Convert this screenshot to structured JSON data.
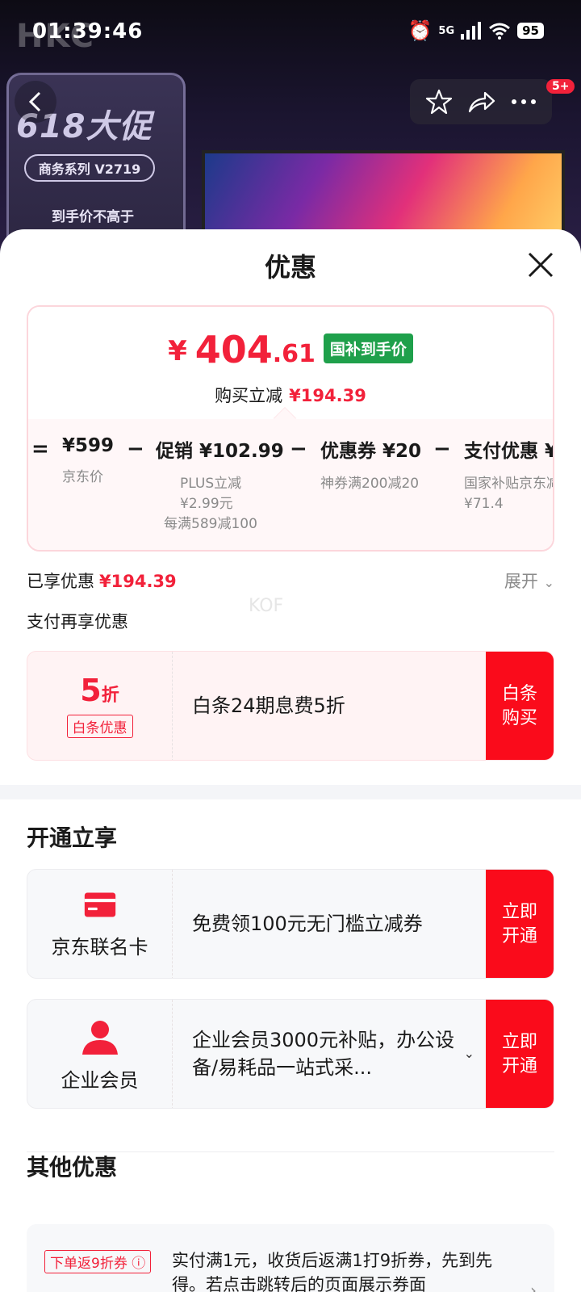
{
  "status_bar": {
    "time": "01:39:46",
    "network": "5G",
    "battery": "95"
  },
  "hero": {
    "brand": "HKC",
    "promo_title": "618大促",
    "series": "商务系列 V2719",
    "price_label": "到手价不高于",
    "badge": "5+"
  },
  "sheet": {
    "title": "优惠"
  },
  "price_card": {
    "currency": "¥",
    "price_int": "404",
    "price_dec": ".61",
    "gov_badge": "国补到手价",
    "sub_label": "购买立减",
    "sub_value": "¥194.39",
    "breakdown": [
      {
        "op": "=",
        "label": "¥599",
        "desc": "京东价"
      },
      {
        "op": "−",
        "label": "促销 ¥102.99",
        "desc": "PLUS立减¥2.99元",
        "desc2": "每满589减100"
      },
      {
        "op": "−",
        "label": "优惠券 ¥20",
        "desc": "神券满200减20"
      },
      {
        "op": "−",
        "label": "支付优惠 ¥",
        "desc": "国家补贴京东减¥71.4"
      }
    ]
  },
  "applied": {
    "label": "已享优惠",
    "value": "¥194.39",
    "expand": "展开"
  },
  "watermark": "KOF",
  "pay_more_label": "支付再享优惠",
  "baitiao": {
    "discount": "5",
    "unit": "折",
    "tag": "白条优惠",
    "desc": "白条24期息费5折",
    "button": "白条购买"
  },
  "activate": {
    "title": "开通立享",
    "cards": [
      {
        "name": "京东联名卡",
        "desc": "免费领100元无门槛立减券",
        "button": "立即开通"
      },
      {
        "name": "企业会员",
        "desc": "企业会员3000元补贴，办公设备/易耗品一站式采...",
        "button": "立即开通"
      }
    ]
  },
  "other": {
    "title": "其他优惠",
    "tag": "下单返9折券",
    "text": "实付满1元，收货后返满1打9折券，先到先得。若点击跳转后的页面展示券面"
  },
  "colors": {
    "accent": "#f2213a",
    "button_red": "#fa0b1b",
    "gov_green": "#1fa04b"
  }
}
